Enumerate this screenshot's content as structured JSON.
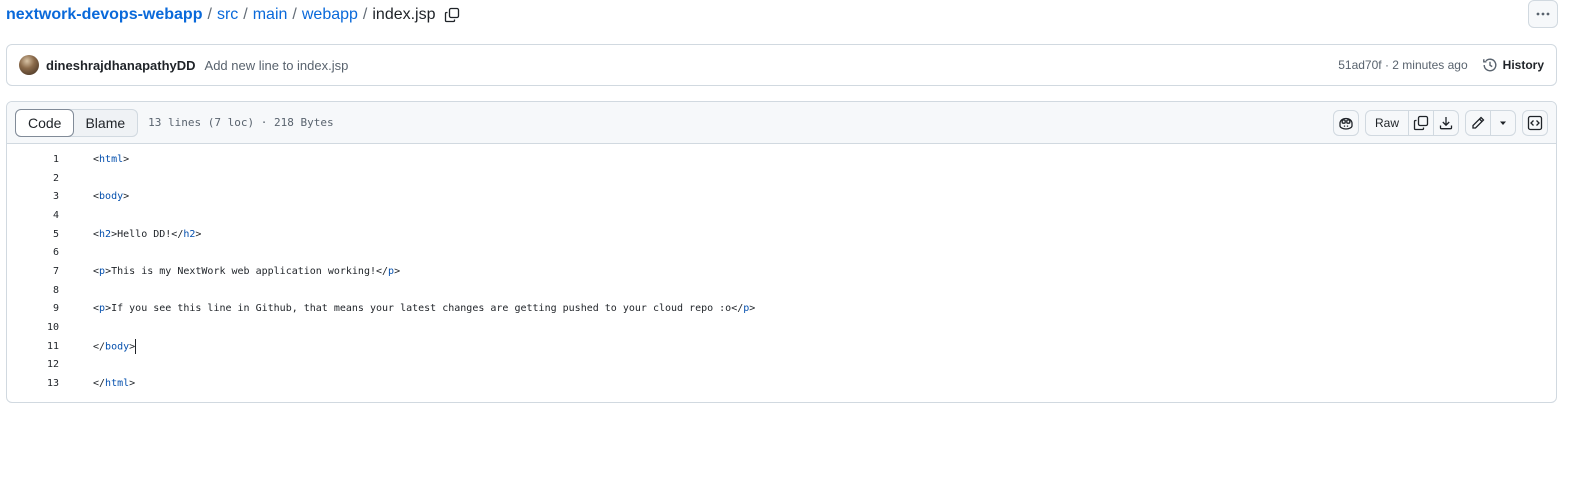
{
  "breadcrumb": {
    "repo": "nextwork-devops-webapp",
    "parts": [
      "src",
      "main",
      "webapp"
    ],
    "file": "index.jsp",
    "separator": "/"
  },
  "commit": {
    "author": "dineshrajdhanapathyDD",
    "message": "Add new line to index.jsp",
    "sha_time": "51ad70f · 2 minutes ago",
    "history_label": "History"
  },
  "file_header": {
    "tabs": [
      "Code",
      "Blame"
    ],
    "active_tab": "Code",
    "meta": "13 lines (7 loc) · 218 Bytes",
    "raw_label": "Raw"
  },
  "code_lines": [
    {
      "n": "1",
      "open": "<",
      "tag": "html",
      "close": ">",
      "rest": ""
    },
    {
      "n": "2",
      "open": "",
      "tag": "",
      "close": "",
      "rest": ""
    },
    {
      "n": "3",
      "open": "<",
      "tag": "body",
      "close": ">",
      "rest": ""
    },
    {
      "n": "4",
      "open": "",
      "tag": "",
      "close": "",
      "rest": ""
    },
    {
      "n": "5",
      "open": "<",
      "tag": "h2",
      "close": ">",
      "rest": "Hello DD!",
      "open2": "</",
      "tag2": "h2",
      "close2": ">"
    },
    {
      "n": "6",
      "open": "",
      "tag": "",
      "close": "",
      "rest": ""
    },
    {
      "n": "7",
      "open": "<",
      "tag": "p",
      "close": ">",
      "rest": "This is my NextWork web application working!",
      "open2": "</",
      "tag2": "p",
      "close2": ">"
    },
    {
      "n": "8",
      "open": "",
      "tag": "",
      "close": "",
      "rest": ""
    },
    {
      "n": "9",
      "open": "<",
      "tag": "p",
      "close": ">",
      "rest": "If you see this line in Github, that means your latest changes are getting pushed to your cloud repo :o",
      "open2": "</",
      "tag2": "p",
      "close2": ">"
    },
    {
      "n": "10",
      "open": "",
      "tag": "",
      "close": "",
      "rest": ""
    },
    {
      "n": "11",
      "open": "</",
      "tag": "body",
      "close": ">",
      "rest": "",
      "caret": true
    },
    {
      "n": "12",
      "open": "",
      "tag": "",
      "close": "",
      "rest": ""
    },
    {
      "n": "13",
      "open": "</",
      "tag": "html",
      "close": ">",
      "rest": ""
    }
  ],
  "icons": {
    "copy_path": "copy-icon",
    "more": "kebab-horizontal-icon",
    "history": "history-icon",
    "copilot": "copilot-icon",
    "copy_raw": "copy-icon",
    "download": "download-icon",
    "edit": "pencil-icon",
    "edit_menu": "triangle-down-icon",
    "symbols": "code-square-icon"
  }
}
